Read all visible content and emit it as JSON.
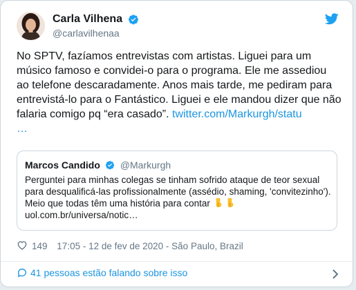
{
  "tweet": {
    "author": {
      "display_name": "Carla Vilhena",
      "handle": "@carlavilhenaa"
    },
    "text_before_link": "No SPTV, fazíamos entrevistas com artistas. Liguei para um músico famoso e convidei-o para o programa. Ele me assediou ao telefone descaradamente. Anos mais tarde, me pediram para entrevistá-lo para o Fantástico. Liguei e ele mandou dizer que não falaria comigo pq “era casado”. ",
    "link": "twitter.com/Markurgh/statu",
    "ellipsis": "…",
    "likes": "149",
    "timestamp": "17:05 - 12 de fev de 2020 - São Paulo, Brazil"
  },
  "quoted": {
    "display_name": "Marcos Candido",
    "handle": "@Markurgh",
    "text": "Perguntei para minhas colegas se tinham sofrido ataque de teor sexual para desqualificá-las profissionalmente (assédio, shaming, 'convitezinho'). Meio que todas têm uma história para contar ",
    "link": "uol.com.br/universa/notic…"
  },
  "conversation": {
    "label": "41 pessoas estão falando sobre isso"
  },
  "icons": {
    "verified": "verified-badge-icon",
    "bird": "twitter-bird-icon",
    "heart": "heart-icon",
    "chat": "chat-bubble-icon",
    "chevron": "chevron-right-icon",
    "emoji": "backhand-index-pointing-down-emoji"
  },
  "colors": {
    "brand": "#1da1f2",
    "link": "#1b95e0",
    "muted": "#657786",
    "border": "#ccd6dd",
    "emoji": "#fbc02d"
  }
}
